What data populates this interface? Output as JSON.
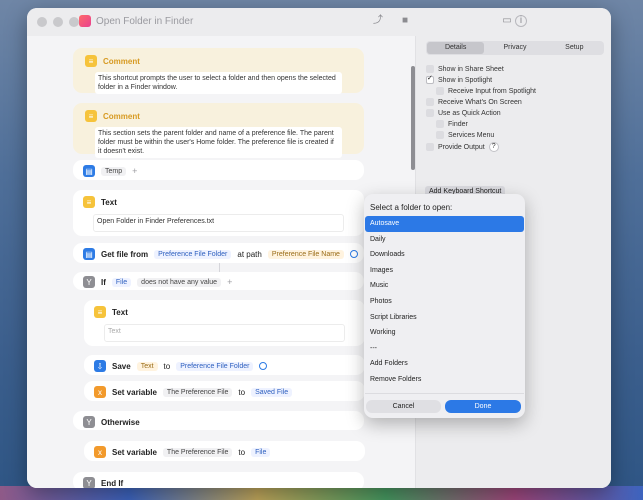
{
  "window": {
    "title": "Open Folder in Finder"
  },
  "actions": {
    "comment1": {
      "label": "Comment",
      "text": "This shortcut prompts the user to select a folder and then opens the selected folder in a Finder window."
    },
    "comment2": {
      "label": "Comment",
      "text": "This section sets the parent folder and name of a preference file. The parent folder must be within the user's Home folder. The preference file is created if it doesn't exist."
    },
    "temp": {
      "label": "Temp"
    },
    "text1": {
      "label": "Text",
      "value": "Open Folder in Finder Preferences.txt"
    },
    "getfile": {
      "label": "Get file from",
      "folder_var": "Preference File Folder",
      "at_path": "at path",
      "name_var": "Preference File Name"
    },
    "if": {
      "label": "If",
      "var": "File",
      "condition": "does not have any value"
    },
    "text2": {
      "label": "Text",
      "placeholder": "Text"
    },
    "save": {
      "label": "Save",
      "var": "Text",
      "to": "to",
      "dest": "Preference File Folder"
    },
    "setvar1": {
      "label": "Set variable",
      "name": "The Preference File",
      "to": "to",
      "value": "Saved File"
    },
    "otherwise": {
      "label": "Otherwise"
    },
    "setvar2": {
      "label": "Set variable",
      "name": "The Preference File",
      "to": "to",
      "value": "File"
    },
    "endif": {
      "label": "End If"
    }
  },
  "sidebar": {
    "tabs": [
      "Details",
      "Privacy",
      "Setup"
    ],
    "options": [
      {
        "label": "Show in Share Sheet",
        "checked": false
      },
      {
        "label": "Show in Spotlight",
        "checked": true
      },
      {
        "label": "Receive Input from Spotlight",
        "checked": false
      },
      {
        "label": "Receive What's On Screen",
        "checked": false
      },
      {
        "label": "Use as Quick Action",
        "checked": false
      },
      {
        "label": "Finder",
        "checked": false
      },
      {
        "label": "Services Menu",
        "checked": false
      },
      {
        "label": "Provide Output",
        "checked": false
      }
    ],
    "keyboard_button": "Add Keyboard Shortcut"
  },
  "dialog": {
    "title": "Select a folder to open:",
    "items": [
      "Autosave",
      "Daily",
      "Downloads",
      "Images",
      "Music",
      "Photos",
      "Script Libraries",
      "Working",
      "---",
      "Add Folders",
      "Remove Folders"
    ],
    "selected": "Autosave",
    "cancel": "Cancel",
    "done": "Done"
  },
  "colors": {
    "accent": "#2c79e6",
    "comment_bg": "#f8f1dd",
    "comment_label": "#d79a22"
  }
}
